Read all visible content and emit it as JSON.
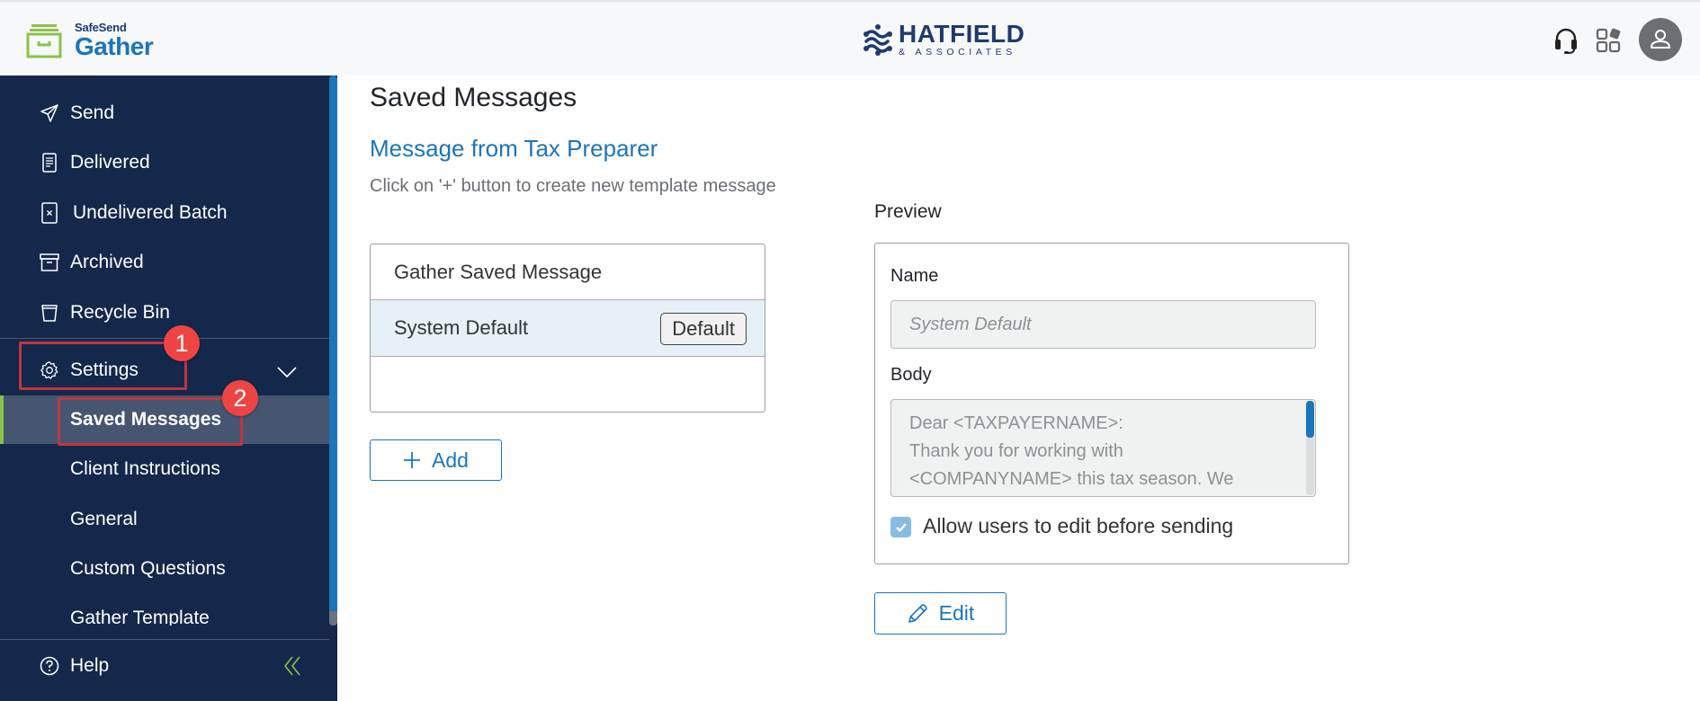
{
  "header": {
    "logo_small": "SafeSend",
    "logo_big": "Gather",
    "brand_main": "HATFIELD",
    "brand_sub": "& ASSOCIATES",
    "icons": [
      "headset-icon",
      "apps-grid-icon",
      "user-avatar-icon"
    ]
  },
  "sidebar": {
    "items": [
      {
        "label": "Send",
        "icon": "send-icon"
      },
      {
        "label": "Delivered",
        "icon": "document-icon"
      },
      {
        "label": "Undelivered Batch",
        "icon": "document-x-icon"
      },
      {
        "label": "Archived",
        "icon": "archive-box-icon"
      },
      {
        "label": "Recycle Bin",
        "icon": "trash-icon"
      }
    ],
    "settings": {
      "label": "Settings",
      "icon": "gear-icon",
      "expanded": true
    },
    "sub_items": [
      {
        "label": "Saved Messages",
        "active": true
      },
      {
        "label": "Client Instructions"
      },
      {
        "label": "General"
      },
      {
        "label": "Custom Questions"
      },
      {
        "label": "Gather Template"
      }
    ],
    "help": {
      "label": "Help",
      "icon": "help-circle-icon"
    },
    "collapse_icon": "double-chevron-left-icon"
  },
  "annotations": [
    {
      "number": "1",
      "target": "Settings"
    },
    {
      "number": "2",
      "target": "Saved Messages"
    }
  ],
  "main": {
    "page_title": "Saved Messages",
    "section_title": "Message from Tax Preparer",
    "hint": "Click on '+' button to create new template message",
    "messages": [
      {
        "name": "Gather Saved Message",
        "selected": false
      },
      {
        "name": "System Default",
        "selected": true,
        "badge": "Default"
      }
    ],
    "add_label": "Add",
    "preview": {
      "title": "Preview",
      "name_label": "Name",
      "name_value": "System Default",
      "body_label": "Body",
      "body_lines": [
        "Dear <TAXPAYERNAME>:",
        "Thank you for working with",
        "<COMPANYNAME> this tax season. We"
      ],
      "allow_edit_label": "Allow users to edit before sending",
      "allow_edit_checked": true
    },
    "edit_label": "Edit"
  },
  "colors": {
    "sidebar_bg": "#14284b",
    "accent_blue": "#1b75bb",
    "active_green": "#8bc34a",
    "annotation_red": "#ef4444"
  }
}
